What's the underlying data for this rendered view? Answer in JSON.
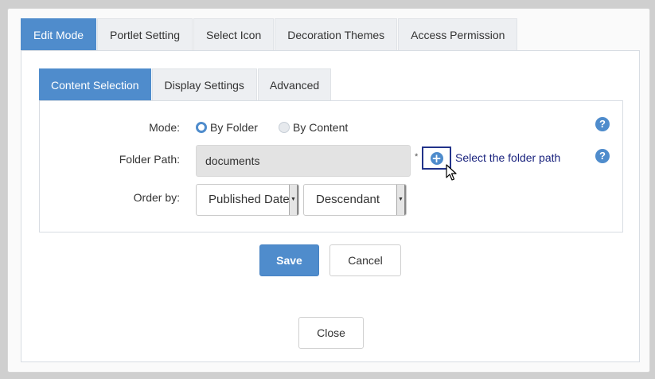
{
  "outer_tabs": [
    {
      "label": "Edit Mode",
      "active": true
    },
    {
      "label": "Portlet Setting",
      "active": false
    },
    {
      "label": "Select Icon",
      "active": false
    },
    {
      "label": "Decoration Themes",
      "active": false
    },
    {
      "label": "Access Permission",
      "active": false
    }
  ],
  "inner_tabs": [
    {
      "label": "Content Selection",
      "active": true
    },
    {
      "label": "Display Settings",
      "active": false
    },
    {
      "label": "Advanced",
      "active": false
    }
  ],
  "form": {
    "mode_label": "Mode:",
    "mode_options": [
      {
        "label": "By Folder",
        "checked": true
      },
      {
        "label": "By Content",
        "checked": false
      }
    ],
    "folder_path_label": "Folder Path:",
    "folder_path_value": "documents",
    "required_marker": "*",
    "select_folder_link": "Select the folder path",
    "order_by_label": "Order by:",
    "order_by_field": "Published Date",
    "order_by_direction": "Descendant",
    "help_glyph": "?"
  },
  "actions": {
    "save_label": "Save",
    "cancel_label": "Cancel",
    "close_label": "Close"
  },
  "colors": {
    "accent": "#4f8ccc",
    "link": "#1a237e",
    "focus_border": "#22338a"
  },
  "icons": {
    "add_folder": "plus-circle-icon",
    "help": "question-circle-icon",
    "dropdown": "caret-down-icon",
    "cursor": "mouse-pointer-icon"
  }
}
